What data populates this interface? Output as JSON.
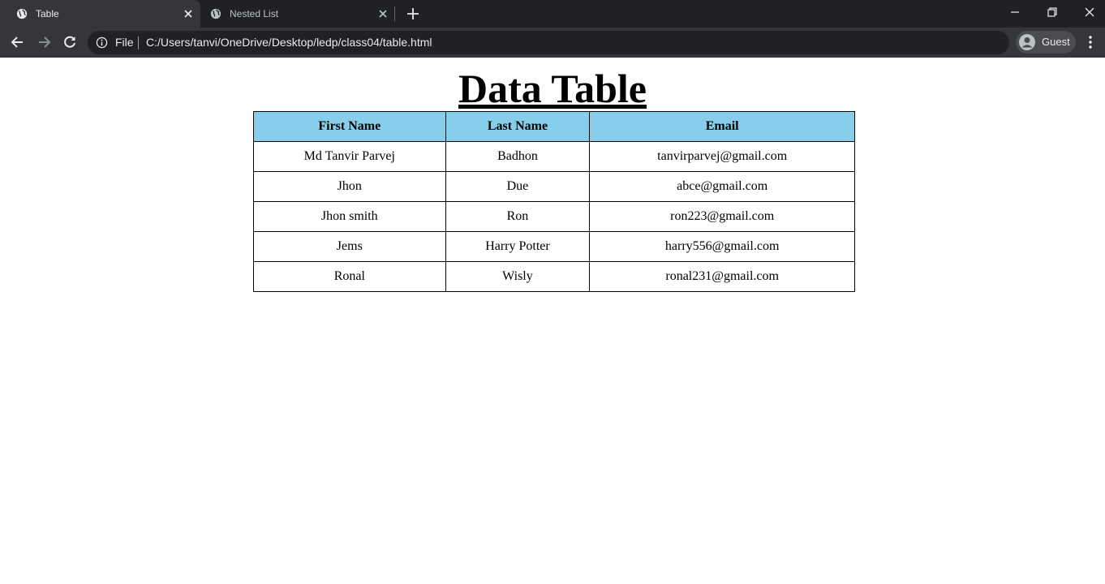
{
  "browser": {
    "tabs": [
      {
        "title": "Table",
        "active": true
      },
      {
        "title": "Nested List",
        "active": false
      }
    ],
    "address_bar": {
      "scheme_label": "File",
      "url": "C:/Users/tanvi/OneDrive/Desktop/ledp/class04/table.html"
    },
    "profile_label": "Guest",
    "colors": {
      "tabstrip": "#202124",
      "toolbar": "#35363a",
      "omnibox": "#202124",
      "header_bg": "#87ceeb"
    }
  },
  "page": {
    "title": "Data Table",
    "table": {
      "headers": [
        "First Name",
        "Last Name",
        "Email"
      ],
      "rows": [
        [
          "Md Tanvir Parvej",
          "Badhon",
          "tanvirparvej@gmail.com"
        ],
        [
          "Jhon",
          "Due",
          "abce@gmail.com"
        ],
        [
          "Jhon smith",
          "Ron",
          "ron223@gmail.com"
        ],
        [
          "Jems",
          "Harry Potter",
          "harry556@gmail.com"
        ],
        [
          "Ronal",
          "Wisly",
          "ronal231@gmail.com"
        ]
      ]
    }
  }
}
